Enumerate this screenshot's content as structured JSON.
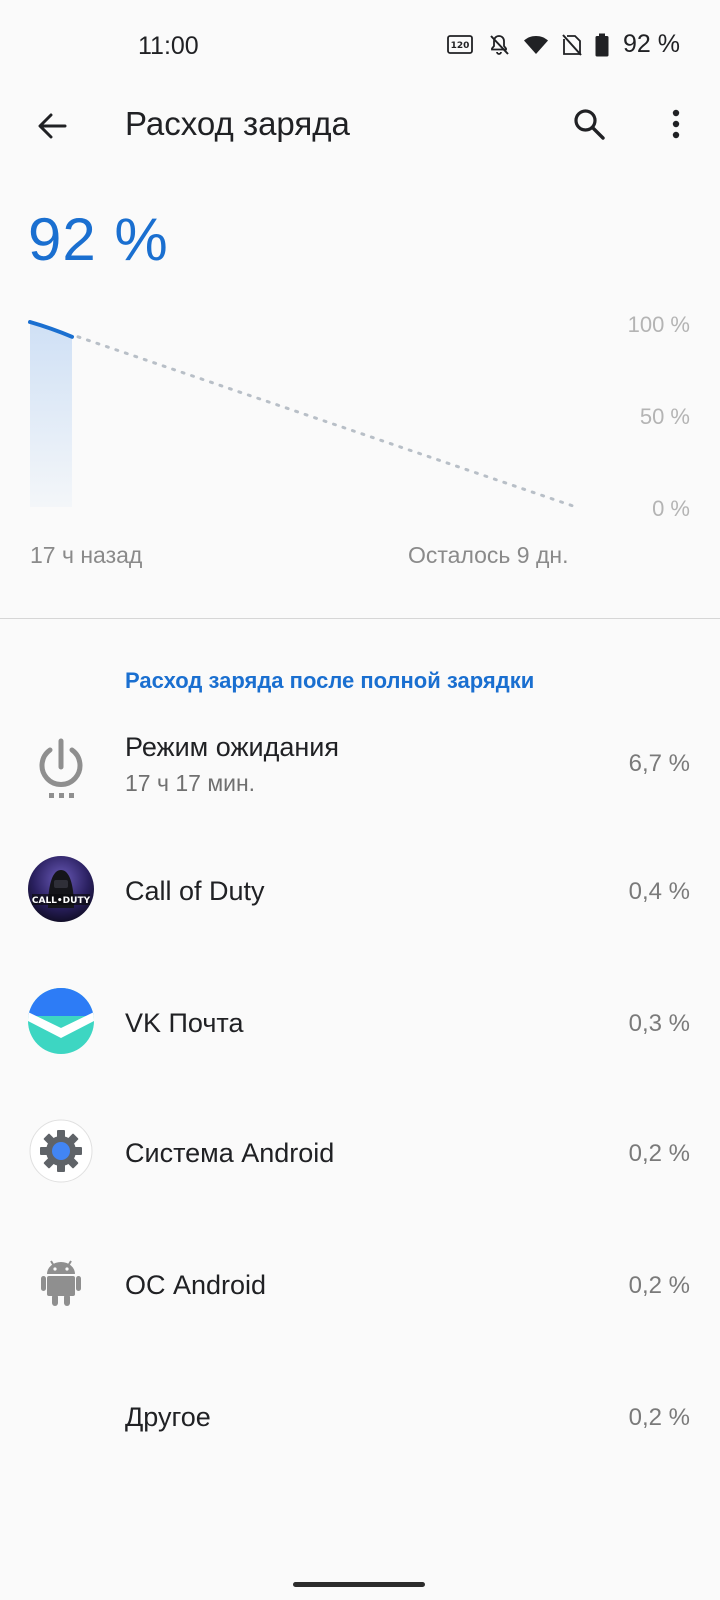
{
  "status_bar": {
    "time": "11:00",
    "battery": "92 %",
    "icons": [
      "refresh-rate-120-icon",
      "bell-off-icon",
      "wifi-icon",
      "no-sim-icon",
      "battery-icon"
    ]
  },
  "app_bar": {
    "title": "Расход заряда",
    "icons": [
      "back-arrow-icon",
      "search-icon",
      "more-vert-icon"
    ]
  },
  "battery_level": "92 %",
  "chart_data": {
    "type": "area",
    "y_ticks": [
      "100 %",
      "50 %",
      "0 %"
    ],
    "x_labels": [
      "17 ч назад",
      "Осталось 9 дн."
    ],
    "ylim": [
      0,
      100
    ],
    "history": [
      100,
      92
    ],
    "projection": [
      92,
      0
    ],
    "colors": {
      "line": "#1a6fd0",
      "fill": "#dbe7f6",
      "projection": "#b8bfc7"
    }
  },
  "section_header": "Расход заряда после полной зарядки",
  "usage_items": [
    {
      "name": "Режим ожидания",
      "sub": "17 ч 17 мин.",
      "percent": "6,7 %",
      "icon": "power-standby-icon"
    },
    {
      "name": "Call of Duty",
      "percent": "0,4 %",
      "icon": "call-of-duty-app-icon",
      "icon_text": "CALL•DUTY"
    },
    {
      "name": "VK Почта",
      "percent": "0,3 %",
      "icon": "vk-mail-app-icon"
    },
    {
      "name": "Система Android",
      "percent": "0,2 %",
      "icon": "android-system-gear-icon"
    },
    {
      "name": "ОС Android",
      "percent": "0,2 %",
      "icon": "android-robot-icon"
    },
    {
      "name": "Другое",
      "percent": "0,2 %",
      "icon": ""
    }
  ],
  "colors": {
    "accent": "#1a6fd0",
    "background": "#fafafa"
  }
}
